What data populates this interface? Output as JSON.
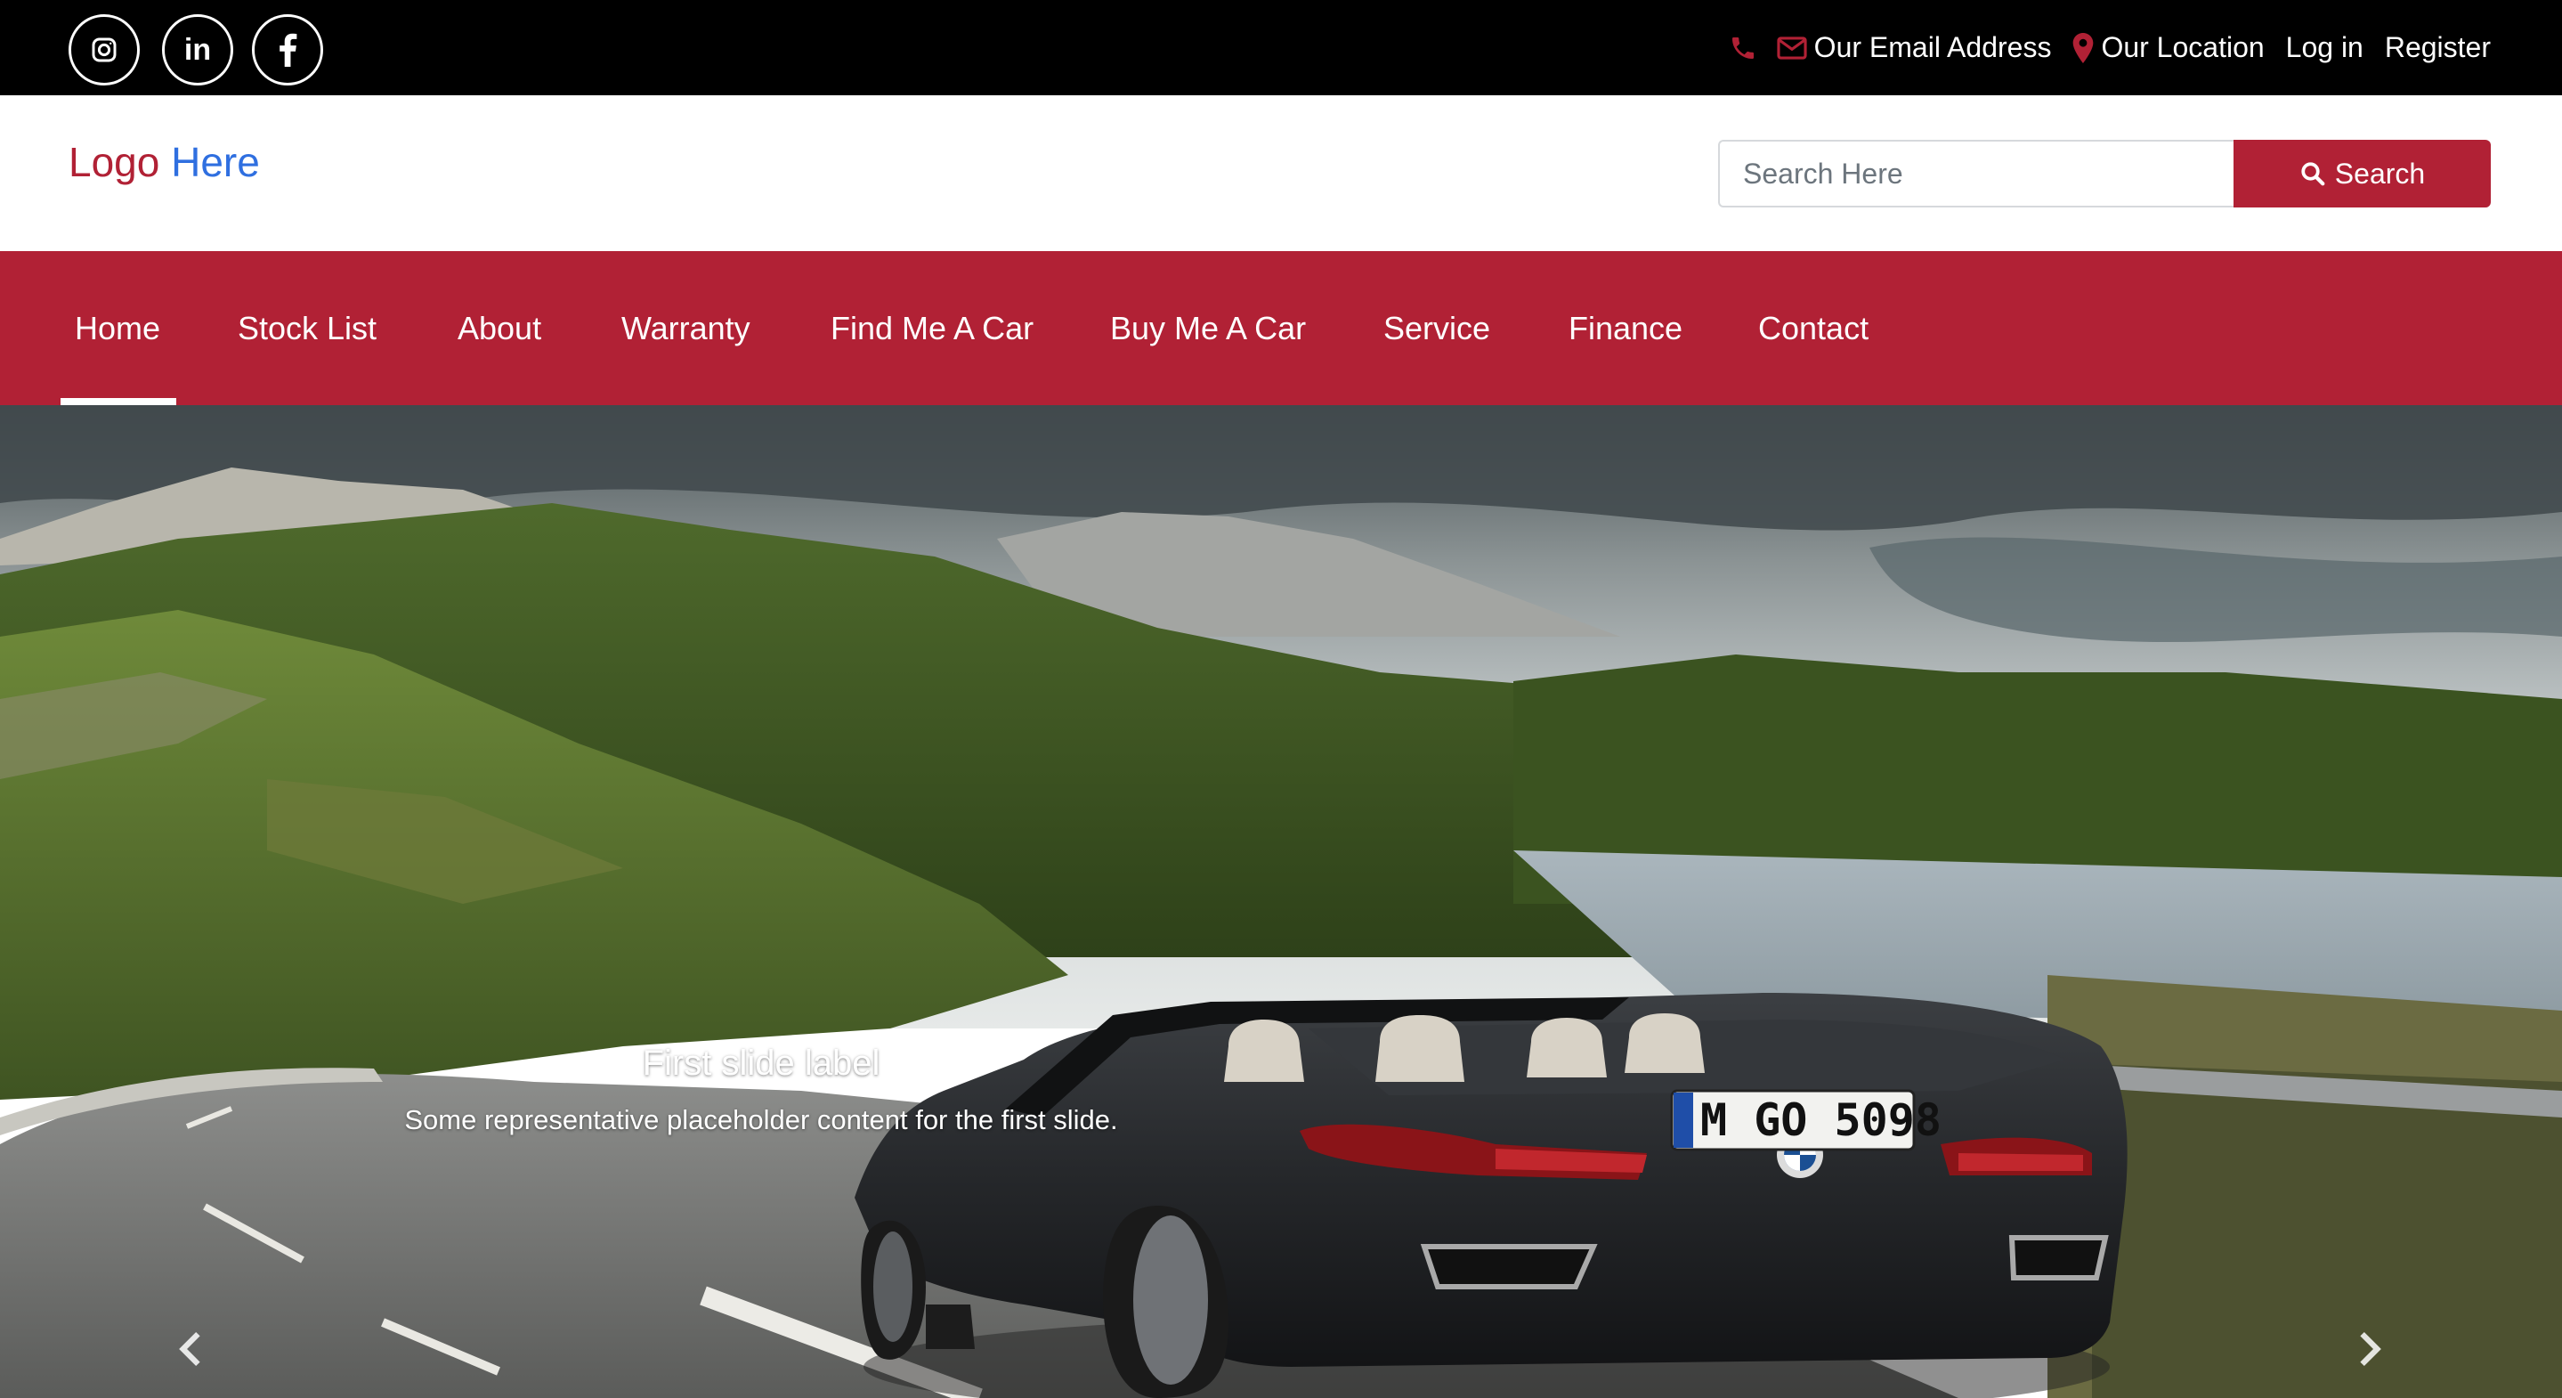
{
  "topbar": {
    "social": [
      "instagram-icon",
      "linkedin-icon",
      "facebook-icon"
    ],
    "linkedin_text": "in",
    "email": "Our Email Address",
    "location": "Our Location",
    "login": "Log in",
    "register": "Register",
    "icon_color": "#b12135"
  },
  "header": {
    "logo_part1": "Logo",
    "logo_part2": "Here",
    "logo_colors": [
      "#b12135",
      "#2f6fe0"
    ],
    "search_placeholder": "Search Here",
    "search_button": "Search"
  },
  "nav": {
    "active": "Home",
    "items": [
      "Home",
      "Stock List",
      "About",
      "Warranty",
      "Find Me A Car",
      "Buy Me A Car",
      "Service",
      "Finance",
      "Contact"
    ],
    "background": "#b12135"
  },
  "hero": {
    "caption_title": "First slide label",
    "caption_text": "Some representative placeholder content for the first slide.",
    "plate": "M GO 5098"
  }
}
